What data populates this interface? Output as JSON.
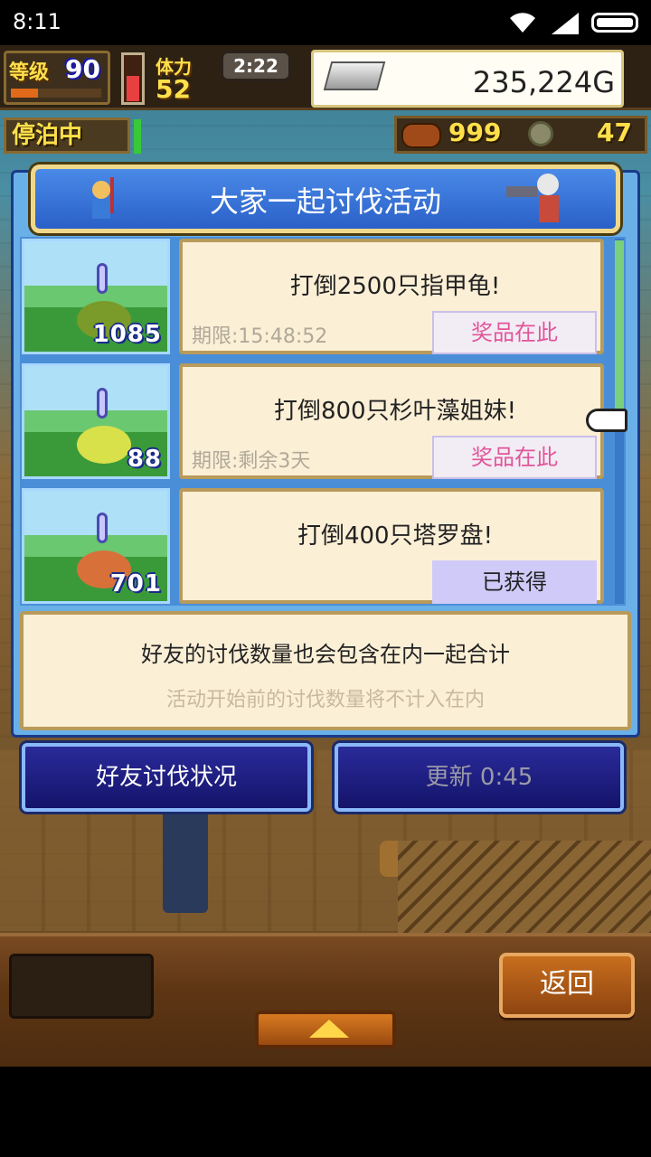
{
  "status_bar": {
    "time": "8:11"
  },
  "hud": {
    "level_label": "等级",
    "level_value": "90",
    "level_progress": 0.3,
    "stamina_label": "体力",
    "stamina_value": "52",
    "timer": "2:22",
    "gold": "235,224G",
    "moored": "停泊中",
    "meat": "999",
    "coins": "47"
  },
  "dialog": {
    "title": "大家一起讨伐活动",
    "missions": [
      {
        "title": "打倒2500只指甲龟!",
        "deadline": "期限:15:48:52",
        "button": "奖品在此",
        "count": "1085",
        "monster_color": "#7a9a2a"
      },
      {
        "title": "打倒800只杉叶藻姐妹!",
        "deadline": "期限:剩余3天",
        "button": "奖品在此",
        "count": "88",
        "monster_color": "#d8e04a"
      },
      {
        "title": "打倒400只塔罗盘!",
        "deadline": "",
        "button": "已获得",
        "count": "701",
        "monster_color": "#d8703a"
      }
    ],
    "note_main": "好友的讨伐数量也会包含在内一起合计",
    "note_sub": "活动开始前的讨伐数量将不计入在内"
  },
  "buttons": {
    "friend_status": "好友讨伐状况",
    "refresh": "更新 0:45",
    "back": "返回"
  }
}
